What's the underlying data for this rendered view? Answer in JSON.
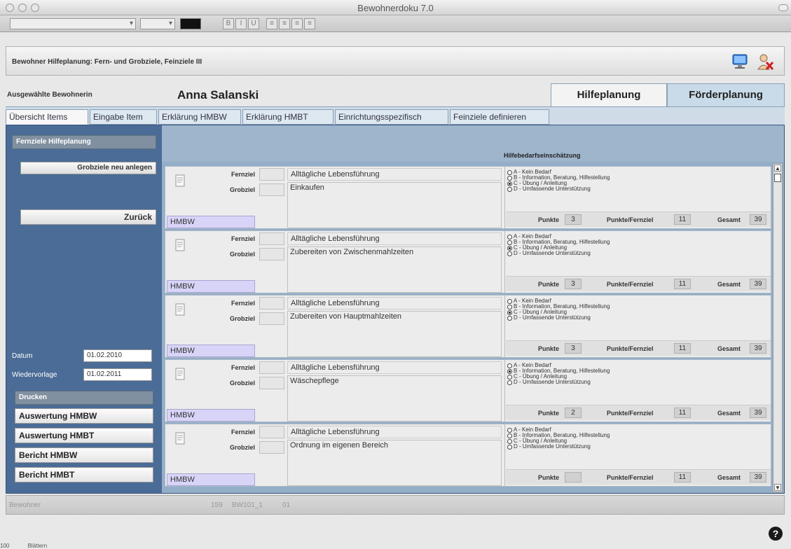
{
  "window": {
    "title": "Bewohnerdoku 7.0"
  },
  "toolbar": {
    "format_buttons": [
      "B",
      "I",
      "U",
      "≡",
      "≡",
      "≡",
      "≡"
    ]
  },
  "header": {
    "title": "Bewohner Hilfeplanung: Fern- und Grobziele, Feinziele III"
  },
  "selection": {
    "label": "Ausgewählte Bewohnerin",
    "name": "Anna Salanski"
  },
  "big_tabs": [
    {
      "label": "Hilfeplanung",
      "active": true
    },
    {
      "label": "Förderplanung",
      "active": false
    }
  ],
  "sub_tabs": [
    {
      "label": "Übersicht Items",
      "active": true
    },
    {
      "label": "Eingabe Item",
      "active": false
    },
    {
      "label": "Erklärung HMBW",
      "active": false
    },
    {
      "label": "Erklärung HMBT",
      "active": false
    },
    {
      "label": "Einrichtungsspezifisch",
      "active": false
    },
    {
      "label": "Feinziele definieren",
      "active": false
    }
  ],
  "sidebar": {
    "section_title": "Fernziele Hilfeplanung",
    "new_button": "Grobziele neu anlegen",
    "back_button": "Zurück",
    "date_label": "Datum",
    "date_value": "01.02.2010",
    "followup_label": "Wiedervorlage",
    "followup_value": "01.02.2011",
    "print_header": "Drucken",
    "print_buttons": [
      "Auswertung HMBW",
      "Auswertung HMBT",
      "Bericht HMBW",
      "Bericht HMBT"
    ]
  },
  "content": {
    "assessment_title": "Hilfebedarfseinschätzung",
    "labels": {
      "fernziel": "Fernziel",
      "grobziel": "Grobziel",
      "punkte": "Punkte",
      "punkte_fernziel": "Punkte/Fernziel",
      "gesamt": "Gesamt"
    },
    "options": [
      "A - Kein Bedarf",
      "B - Information, Beratung, Hilfestellung",
      "C - Übung / Anleitung",
      "D - Umfassende Unterstützung"
    ],
    "records": [
      {
        "fernziel": "Alltägliche Lebensführung",
        "grobziel": "Einkaufen",
        "code": "HMBW",
        "selected": 2,
        "punkte": "3",
        "punkte_fernziel": "11",
        "gesamt": "39"
      },
      {
        "fernziel": "Alltägliche Lebensführung",
        "grobziel": "Zubereiten von Zwischenmahlzeiten",
        "code": "HMBW",
        "selected": 2,
        "punkte": "3",
        "punkte_fernziel": "11",
        "gesamt": "39"
      },
      {
        "fernziel": "Alltägliche Lebensführung",
        "grobziel": "Zubereiten von Hauptmahlzeiten",
        "code": "HMBW",
        "selected": 2,
        "punkte": "3",
        "punkte_fernziel": "11",
        "gesamt": "39"
      },
      {
        "fernziel": "Alltägliche Lebensführung",
        "grobziel": "Wäschepflege",
        "code": "HMBW",
        "selected": 1,
        "punkte": "2",
        "punkte_fernziel": "11",
        "gesamt": "39"
      },
      {
        "fernziel": "Alltägliche Lebensführung",
        "grobziel": "Ordnung im eigenen Bereich",
        "code": "HMBW",
        "selected": -1,
        "punkte": "",
        "punkte_fernziel": "11",
        "gesamt": "39"
      }
    ]
  },
  "status": {
    "label": "Bewohner",
    "ids": [
      "159",
      "BW101_1",
      "01"
    ]
  },
  "bottom": {
    "zoom": "100",
    "mode": "Blättern"
  },
  "colors": {
    "panel": "#4a6c96",
    "content": "#94aec8",
    "code_field": "#d8d4f8",
    "tab_active": "#f3f3f3"
  }
}
